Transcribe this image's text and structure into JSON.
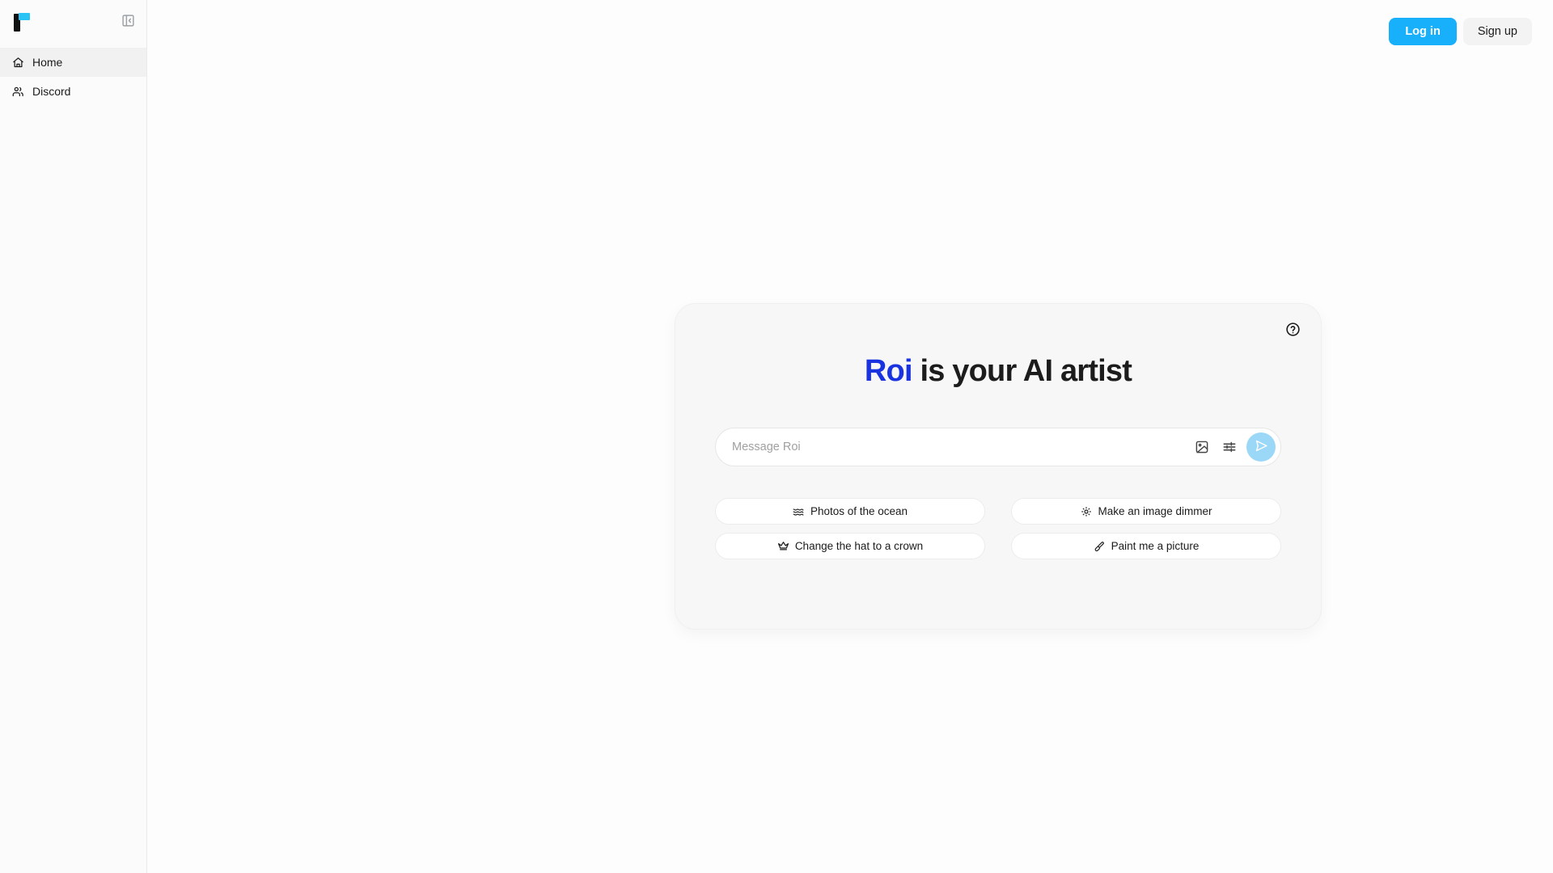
{
  "brand": {
    "logo_name": "roi-logo",
    "logo_bar_color": "#111111",
    "logo_accent_color": "#29c3f5"
  },
  "sidebar": {
    "collapse_icon": "panel-collapse-icon",
    "items": [
      {
        "label": "Home",
        "icon": "home-icon",
        "active": true
      },
      {
        "label": "Discord",
        "icon": "users-icon",
        "active": false
      }
    ]
  },
  "topbar": {
    "login_label": "Log in",
    "signup_label": "Sign up",
    "login_color": "#18b0fb",
    "signup_bg": "#f3f3f3"
  },
  "hero": {
    "help_icon": "help-circle-icon",
    "title_brand": "Roi",
    "title_rest": " is your AI artist",
    "brand_color": "#1a33e0"
  },
  "composer": {
    "placeholder": "Message Roi",
    "value": "",
    "image_icon": "image-icon",
    "settings_icon": "sliders-icon",
    "send_icon": "send-icon",
    "send_bg": "#9bd7f7"
  },
  "suggestions": [
    {
      "label": "Photos of the ocean",
      "icon": "waves-icon"
    },
    {
      "label": "Make an image dimmer",
      "icon": "sun-dim-icon"
    },
    {
      "label": "Change the hat to a crown",
      "icon": "crown-icon"
    },
    {
      "label": "Paint me a picture",
      "icon": "paintbrush-icon"
    }
  ]
}
